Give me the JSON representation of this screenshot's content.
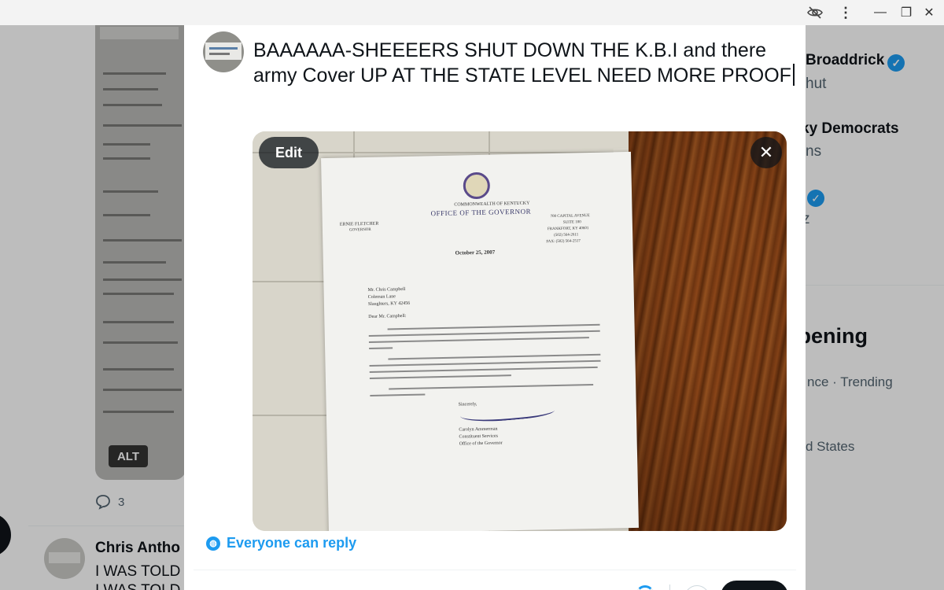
{
  "window": {
    "eye_icon": "eye-off-icon",
    "menu_glyph": "⋮",
    "minimize_glyph": "—",
    "maximize_glyph": "❐",
    "close_glyph": "✕"
  },
  "background": {
    "alt_badge": "ALT",
    "reply_count": "3",
    "post": {
      "author": "Chris Antho",
      "line1": "I WAS TOLD",
      "line2": "I WAS TOLD"
    },
    "right_column": {
      "item1_name": "Broaddrick",
      "item1_sub": "hut",
      "item2_name": "ky Democrats",
      "item2_sub": "ns",
      "item3_sub": "z",
      "section_title": "ppening",
      "trend_meta": "nce · Trending",
      "location": "d States"
    }
  },
  "compose": {
    "text": "BAAAAAA-SHEEEERS SHUT DOWN THE K.B.I and there army   Cover UP AT THE STATE  LEVEL NEED MORE PROOF",
    "media": {
      "edit_label": "Edit",
      "close_glyph": "✕",
      "letter": {
        "org_line1": "COMMONWEALTH OF KENTUCKY",
        "org_line2": "OFFICE OF THE GOVERNOR",
        "governor_name": "ERNIE FLETCHER",
        "governor_title": "GOVERNOR",
        "address_line1": "700 CAPITAL AVENUE",
        "address_line2": "SUITE 100",
        "address_line3": "FRANKFORT, KY 40601",
        "address_line4": "(502) 564-2611",
        "address_line5": "FAX: (502) 564-2517",
        "date": "October 25, 2007",
        "recipient1": "Mr. Chris Campbell",
        "recipient2": "Coleman Lane",
        "recipient3": "Slaughters, KY  42456",
        "salutation": "Dear Mr. Campbell:",
        "closing": "Sincerely,",
        "signer_name": "Carolyn Ammerman",
        "signer_title1": "Constituent Services",
        "signer_title2": "Office of the Governor"
      }
    },
    "reply_setting": "Everyone can reply",
    "add_glyph": "+"
  },
  "colors": {
    "accent": "#1d9bf0",
    "text": "#0f1419",
    "muted": "#536471"
  }
}
